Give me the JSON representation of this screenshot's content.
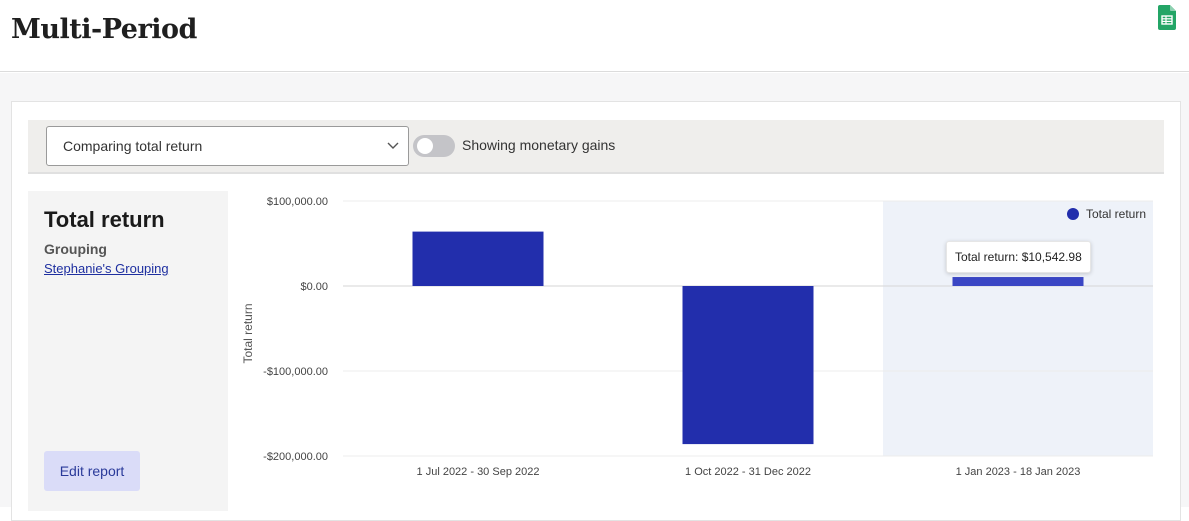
{
  "header": {
    "title": "Multi-Period",
    "export_icon": "google-sheets-icon"
  },
  "toolbar": {
    "select_value": "Comparing total return",
    "toggle_label": "Showing monetary gains",
    "toggle_on": false
  },
  "side": {
    "title": "Total return",
    "grouping_label": "Grouping",
    "grouping_link": "Stephanie's Grouping",
    "edit_label": "Edit report"
  },
  "tooltip": {
    "text": "Total return: $10,542.98"
  },
  "colors": {
    "bar": "#222eac",
    "bar_hover": "#3a46c4",
    "highlight_bg": "#eef2f9",
    "accent": "#2a3a9a"
  },
  "chart_data": {
    "type": "bar",
    "categories": [
      "1 Jul 2022 - 30 Sep 2022",
      "1 Oct 2022 - 31 Dec 2022",
      "1 Jan 2023 - 18 Jan 2023"
    ],
    "series": [
      {
        "name": "Total return",
        "values": [
          64000,
          -186000,
          10542.98
        ]
      }
    ],
    "ylabel": "Total return",
    "ylim": [
      -200000,
      100000
    ],
    "yticks": [
      100000,
      0,
      -100000,
      -200000
    ],
    "ytick_labels": [
      "$100,000.00",
      "$0.00",
      "-$100,000.00",
      "-$200,000.00"
    ],
    "legend": "top-right",
    "highlighted_index": 2,
    "grid": true
  }
}
